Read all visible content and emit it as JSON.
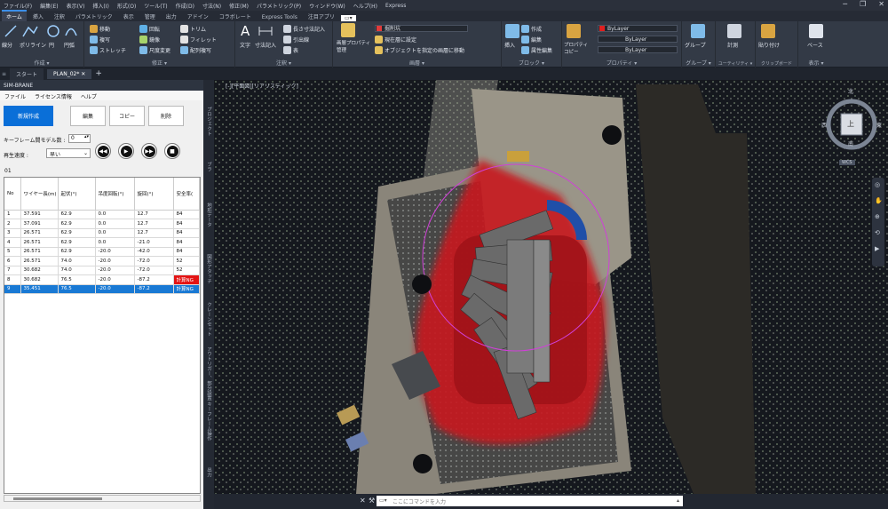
{
  "menubar": {
    "items": [
      "ファイル(F)",
      "編集(E)",
      "表示(V)",
      "挿入(I)",
      "形式(O)",
      "ツール(T)",
      "作成(D)",
      "寸法(N)",
      "修正(M)",
      "パラメトリック(P)",
      "ウィンドウ(W)",
      "ヘルプ(H)",
      "Express"
    ]
  },
  "ribbon_tabs": [
    "ホーム",
    "挿入",
    "注釈",
    "パラメトリック",
    "表示",
    "管理",
    "出力",
    "アドイン",
    "コラボレート",
    "Express Tools",
    "注目アプリ"
  ],
  "ribbon": {
    "draw": {
      "line": "線分",
      "polyline": "ポリライン",
      "circle": "円",
      "arc": "円弧",
      "panel": "作成 ▾"
    },
    "modify": {
      "move": "移動",
      "rotate": "回転",
      "trim": "トリム",
      "copy": "複写",
      "mirror": "鏡像",
      "fillet": "フィレット",
      "stretch": "ストレッチ",
      "scale": "尺度変更",
      "array": "配列複写",
      "panel": "修正 ▾"
    },
    "annotation": {
      "text": "文字",
      "dim": "寸法記入",
      "linear": "長さ寸法記入",
      "leader": "引出線",
      "table": "表",
      "panel": "注釈 ▾"
    },
    "layers": {
      "props": "画層プロパティ管理",
      "layer": "掘削坑",
      "set_current": "現在層に設定",
      "move_to": "オブジェクトを指定の画層に移動",
      "panel": "画層 ▾"
    },
    "block": {
      "insert": "挿入",
      "create": "作成",
      "edit": "編集",
      "attr": "属性編集",
      "panel": "ブロック ▾"
    },
    "properties": {
      "match": "プロパティコピー",
      "layer": "ByLayer",
      "linetype": "ByLayer",
      "lineweight": "ByLayer",
      "panel": "プロパティ ▾"
    },
    "groups": {
      "group": "グループ",
      "panel": "グループ ▾"
    },
    "utilities": {
      "measure": "計測",
      "panel": "ユーティリティ ▾"
    },
    "clipboard": {
      "paste": "貼り付け",
      "panel": "クリップボード"
    },
    "view": {
      "base": "ベース",
      "panel": "表示 ▾"
    }
  },
  "doc_tabs": {
    "start": "スタート",
    "active": "PLAN_02*",
    "add": "+"
  },
  "sim": {
    "title": "SIM-BRANE",
    "menu": [
      "ファイル",
      "ライセンス情報",
      "ヘルプ"
    ],
    "btn_new": "新規作成",
    "btn_edit": "編集",
    "btn_copy": "コピー",
    "btn_delete": "削除",
    "keyframe_label": "キーフレーム間モデル数 :",
    "keyframe_value": "0",
    "speed_label": "再生速度 :",
    "speed_value": "早い",
    "list_id": "01",
    "columns": [
      "No",
      "ワイヤー長(m)",
      "起伏(°)",
      "吊度回転(°)",
      "旋回(°)",
      "安全率("
    ],
    "rows": [
      [
        "1",
        "37.591",
        "62.9",
        "0.0",
        "12.7",
        "84"
      ],
      [
        "2",
        "37.091",
        "62.9",
        "0.0",
        "12.7",
        "84"
      ],
      [
        "3",
        "26.571",
        "62.9",
        "0.0",
        "12.7",
        "84"
      ],
      [
        "4",
        "26.571",
        "62.9",
        "0.0",
        "-21.0",
        "84"
      ],
      [
        "5",
        "26.571",
        "62.9",
        "-20.0",
        "-42.0",
        "84"
      ],
      [
        "6",
        "26.571",
        "74.0",
        "-20.0",
        "-72.0",
        "52"
      ],
      [
        "7",
        "30.682",
        "74.0",
        "-20.0",
        "-72.0",
        "52"
      ],
      [
        "8",
        "30.682",
        "76.5",
        "-20.0",
        "-87.2",
        "計算NG"
      ],
      [
        "9",
        "35.451",
        "76.5",
        "-20.0",
        "-87.2",
        "計算NG"
      ]
    ]
  },
  "palette_tabs": [
    "プロジェクト",
    "ブラ",
    "地形データ",
    "図形アタッチ",
    "クレーンセット",
    "アウトリガー、部分設置",
    "キーフレーム操作",
    "出力"
  ],
  "viewport": {
    "label": "[-][平面図][リアリスティック]",
    "cube_top": "上",
    "cube_n": "北",
    "cube_s": "南",
    "cube_e": "東",
    "cube_w": "西",
    "wcs": "WCS"
  },
  "command": {
    "placeholder": "ここにコマンドを入力"
  }
}
